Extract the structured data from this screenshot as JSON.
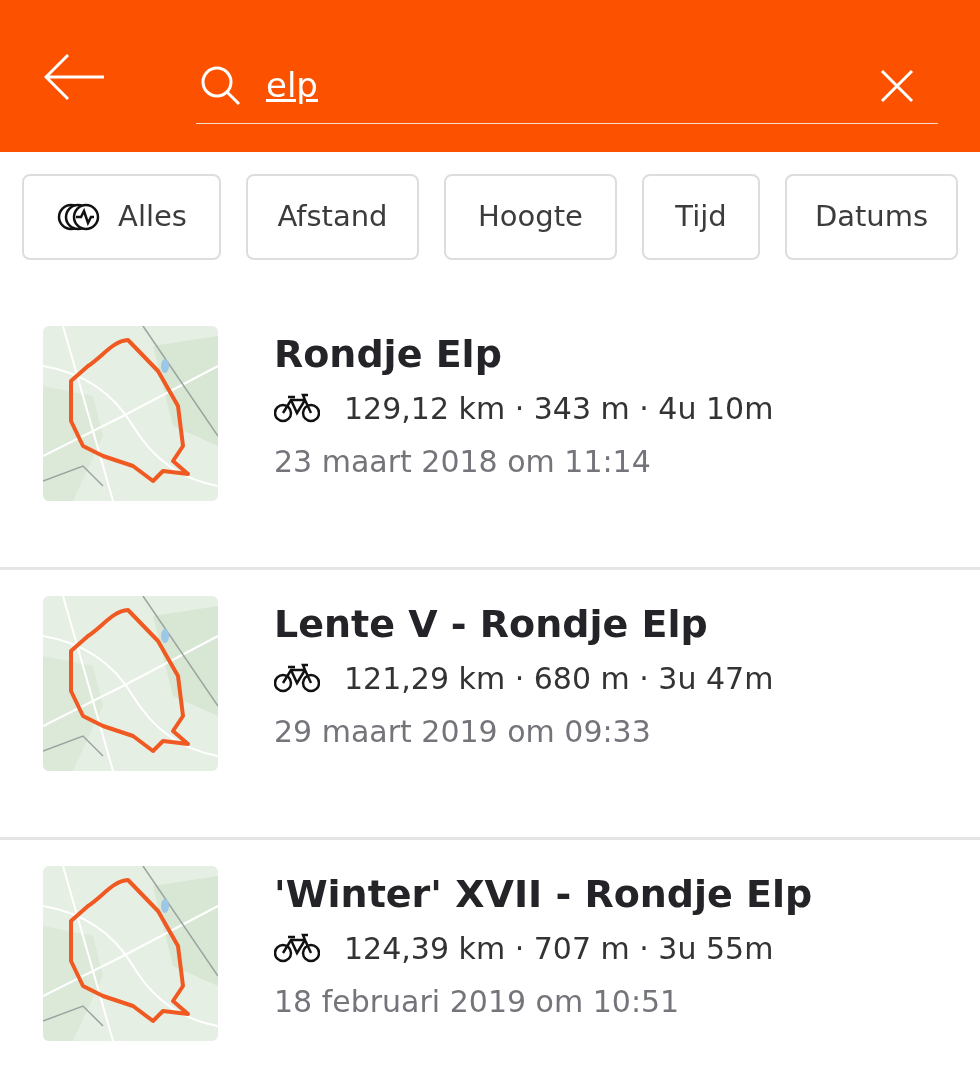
{
  "search": {
    "value": "elp"
  },
  "filters": [
    {
      "label": "Alles",
      "kind": "activity"
    },
    {
      "label": "Afstand",
      "kind": "plain"
    },
    {
      "label": "Hoogte",
      "kind": "plain"
    },
    {
      "label": "Tijd",
      "kind": "plain"
    },
    {
      "label": "Datums",
      "kind": "plain"
    }
  ],
  "activities": [
    {
      "title": "Rondje Elp",
      "kind": "ride",
      "stats": "129,12 km · 343 m · 4u 10m",
      "date": "23 maart 2018 om 11:14"
    },
    {
      "title": "Lente V - Rondje Elp",
      "kind": "ride",
      "stats": "121,29 km · 680 m · 3u 47m",
      "date": "29 maart 2019 om 09:33"
    },
    {
      "title": "'Winter' XVII - Rondje Elp",
      "kind": "ride",
      "stats": "124,39 km · 707 m · 3u 55m",
      "date": "18 februari 2019 om 10:51"
    }
  ]
}
